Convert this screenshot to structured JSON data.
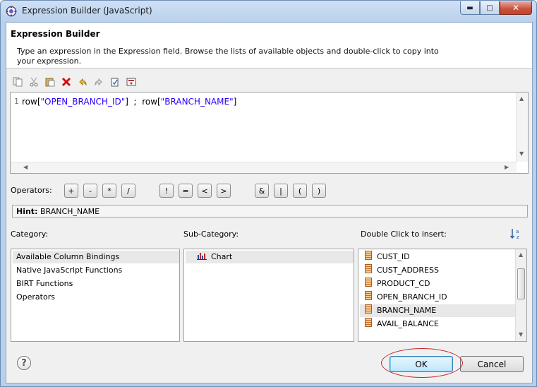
{
  "window": {
    "title": "Expression Builder (JavaScript)",
    "min_glyph": "▬",
    "max_glyph": "□",
    "close_glyph": "✕"
  },
  "header": {
    "title": "Expression Builder",
    "description": "Type an expression in the Expression field. Browse the lists of available objects and double-click to copy into your expression."
  },
  "toolbar": {
    "icons": [
      "copy-icon",
      "cut-icon",
      "paste-icon",
      "delete-icon",
      "undo-icon",
      "redo-icon",
      "validate-icon",
      "calculator-icon"
    ]
  },
  "editor": {
    "line_number": "1",
    "code_prefix1": "row[",
    "string1": "\"OPEN_BRANCH_ID\"",
    "code_mid": "]  ;  row[",
    "string2": "\"BRANCH_NAME\"",
    "code_end": "]"
  },
  "operators": {
    "label": "Operators:",
    "buttons": [
      "+",
      "-",
      "*",
      "/",
      "!",
      "=",
      "<",
      ">",
      "&",
      "|",
      "(",
      ")"
    ]
  },
  "hint": {
    "label": "Hint:",
    "value": " BRANCH_NAME"
  },
  "category": {
    "label": "Category:",
    "items": [
      "Available Column Bindings",
      "Native JavaScript Functions",
      "BIRT Functions",
      "Operators"
    ],
    "selected": "Available Column Bindings"
  },
  "subcategory": {
    "label": "Sub-Category:",
    "items": [
      "Chart"
    ]
  },
  "insert": {
    "label": "Double Click to insert:",
    "items": [
      "CUST_ID",
      "CUST_ADDRESS",
      "PRODUCT_CD",
      "OPEN_BRANCH_ID",
      "BRANCH_NAME",
      "AVAIL_BALANCE"
    ],
    "selected": "BRANCH_NAME",
    "sort_icon": "sort-az-icon"
  },
  "buttons": {
    "help": "?",
    "ok": "OK",
    "cancel": "Cancel"
  },
  "colors": {
    "string_literal": "#2a00ff",
    "highlight_ring": "#c0282a"
  }
}
